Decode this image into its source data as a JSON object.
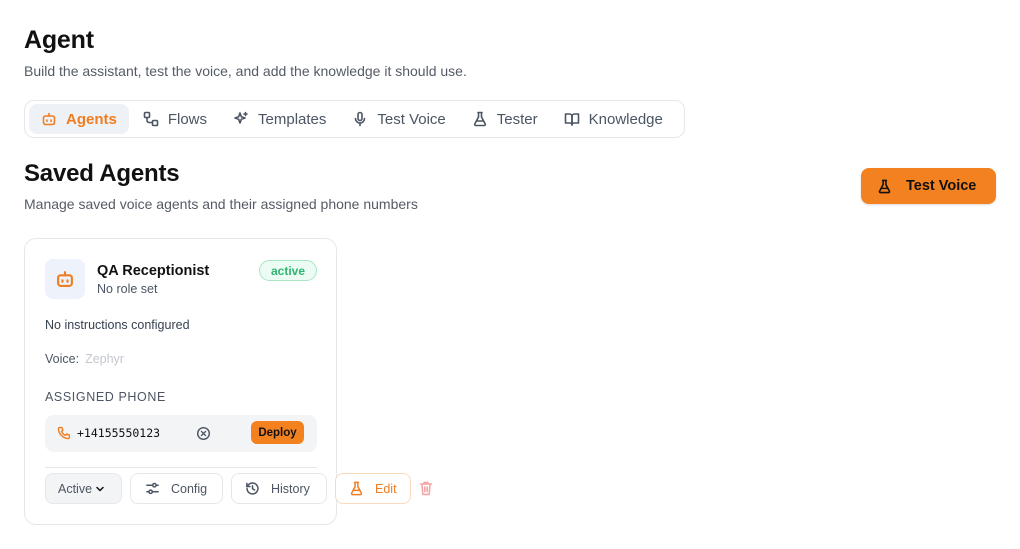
{
  "header": {
    "title": "Agent",
    "subtitle": "Build the assistant, test the voice, and add the knowledge it should use."
  },
  "tabs": [
    {
      "label": "Agents",
      "icon": "bot-icon",
      "active": true
    },
    {
      "label": "Flows",
      "icon": "flows-icon",
      "active": false
    },
    {
      "label": "Templates",
      "icon": "sparkles-icon",
      "active": false
    },
    {
      "label": "Test Voice",
      "icon": "microphone-icon",
      "active": false
    },
    {
      "label": "Tester",
      "icon": "flask-icon",
      "active": false
    },
    {
      "label": "Knowledge",
      "icon": "book-icon",
      "active": false
    }
  ],
  "section": {
    "title": "Saved Agents",
    "subtitle": "Manage saved voice agents and their assigned phone numbers",
    "test_voice_button": "Test Voice"
  },
  "agent_card": {
    "name": "QA Receptionist",
    "role": "No role set",
    "status": "active",
    "instructions": "No instructions configured",
    "voice_label": "Voice:",
    "voice_value": "Zephyr",
    "assigned_phone_label": "ASSIGNED PHONE",
    "phone_number": "+14155550123",
    "deploy_label": "Deploy",
    "status_select": "Active",
    "config_label": "Config",
    "history_label": "History",
    "edit_label": "Edit"
  },
  "colors": {
    "accent": "#f4811f",
    "active_badge": "#2fb56f",
    "delete": "#f4a5a5"
  }
}
